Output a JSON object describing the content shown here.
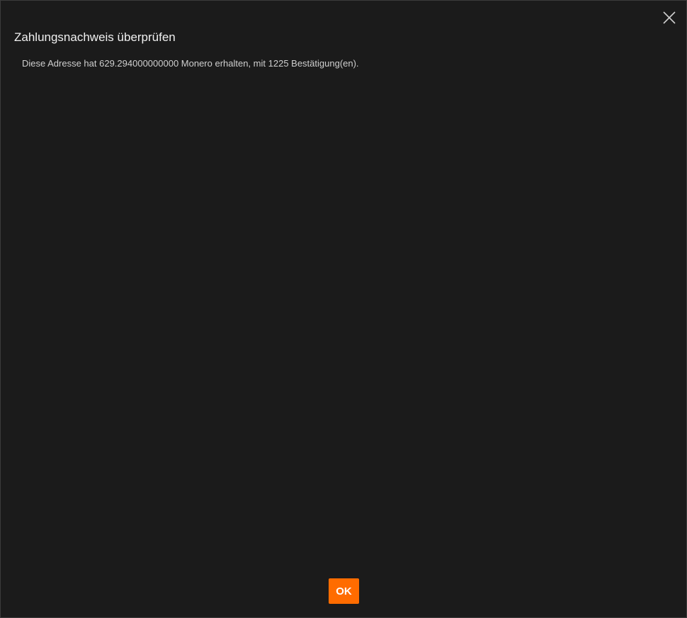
{
  "dialog": {
    "title": "Zahlungsnachweis überprüfen",
    "message": "Diese Adresse hat 629.294000000000 Monero erhalten, mit 1225 Bestätigung(en).",
    "close_icon": "close-icon",
    "ok_label": "OK"
  },
  "colors": {
    "accent": "#ff6c00",
    "background": "#1b1b1b",
    "text": "#e6e6e6"
  }
}
